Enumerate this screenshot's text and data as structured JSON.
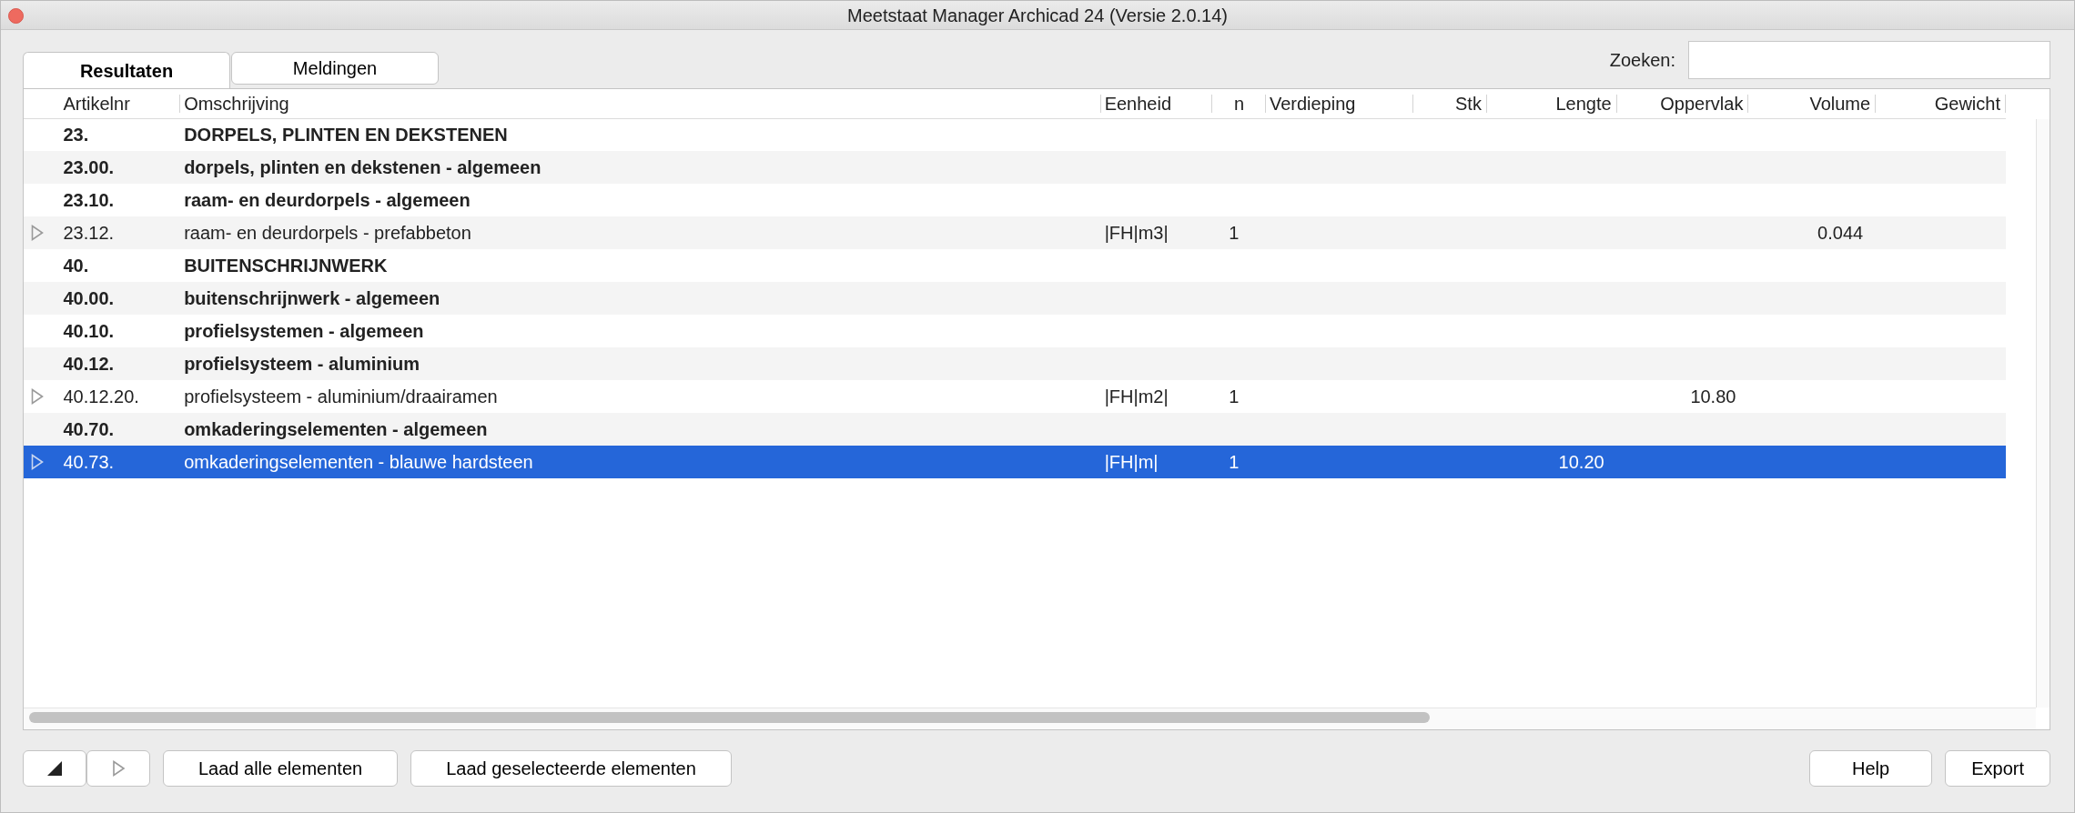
{
  "window": {
    "title": "Meetstaat Manager Archicad 24 (Versie 2.0.14)"
  },
  "tabs": [
    {
      "label": "Resultaten",
      "selected": true
    },
    {
      "label": "Meldingen",
      "selected": false
    }
  ],
  "search": {
    "label": "Zoeken:"
  },
  "table": {
    "columns": [
      "Artikelnr",
      "Omschrijving",
      "Eenheid",
      "n",
      "Verdieping",
      "Stk",
      "Lengte",
      "Oppervlak",
      "Volume",
      "Gewicht"
    ],
    "rows": [
      {
        "kind": "group",
        "selected": false,
        "cells": [
          "23.",
          "DORPELS, PLINTEN EN DEKSTENEN",
          null,
          null,
          null,
          null,
          null,
          null,
          null,
          null
        ]
      },
      {
        "kind": "group",
        "selected": false,
        "cells": [
          "23.00.",
          "dorpels, plinten en dekstenen - algemeen",
          null,
          null,
          null,
          null,
          null,
          null,
          null,
          null
        ]
      },
      {
        "kind": "group",
        "selected": false,
        "cells": [
          "23.10.",
          "raam- en deurdorpels - algemeen",
          null,
          null,
          null,
          null,
          null,
          null,
          null,
          null
        ]
      },
      {
        "kind": "item",
        "selected": false,
        "cells": [
          "23.12.",
          "raam- en deurdorpels - prefabbeton",
          "|FH|m3|",
          "1",
          null,
          null,
          null,
          null,
          "0.044",
          null
        ]
      },
      {
        "kind": "group",
        "selected": false,
        "cells": [
          "40.",
          "BUITENSCHRIJNWERK",
          null,
          null,
          null,
          null,
          null,
          null,
          null,
          null
        ]
      },
      {
        "kind": "group",
        "selected": false,
        "cells": [
          "40.00.",
          "buitenschrijnwerk - algemeen",
          null,
          null,
          null,
          null,
          null,
          null,
          null,
          null
        ]
      },
      {
        "kind": "group",
        "selected": false,
        "cells": [
          "40.10.",
          "profielsystemen - algemeen",
          null,
          null,
          null,
          null,
          null,
          null,
          null,
          null
        ]
      },
      {
        "kind": "group",
        "selected": false,
        "cells": [
          "40.12.",
          "profielsysteem - aluminium",
          null,
          null,
          null,
          null,
          null,
          null,
          null,
          null
        ]
      },
      {
        "kind": "item",
        "selected": false,
        "cells": [
          "40.12.20.",
          "profielsysteem - aluminium/draairamen",
          "|FH|m2|",
          "1",
          null,
          null,
          null,
          "10.80",
          null,
          null
        ]
      },
      {
        "kind": "group",
        "selected": false,
        "cells": [
          "40.70.",
          "omkaderingselementen - algemeen",
          null,
          null,
          null,
          null,
          null,
          null,
          null,
          null
        ]
      },
      {
        "kind": "item",
        "selected": true,
        "cells": [
          "40.73.",
          "omkaderingselementen - blauwe hardsteen",
          "|FH|m|",
          "1",
          null,
          null,
          "10.20",
          null,
          null,
          null
        ]
      }
    ]
  },
  "buttons_left": [
    {
      "label": "Laad alle elementen"
    },
    {
      "label": "Laad geselecteerde elementen"
    }
  ],
  "buttons_right": [
    {
      "label": "Help"
    },
    {
      "label": "Export"
    }
  ]
}
